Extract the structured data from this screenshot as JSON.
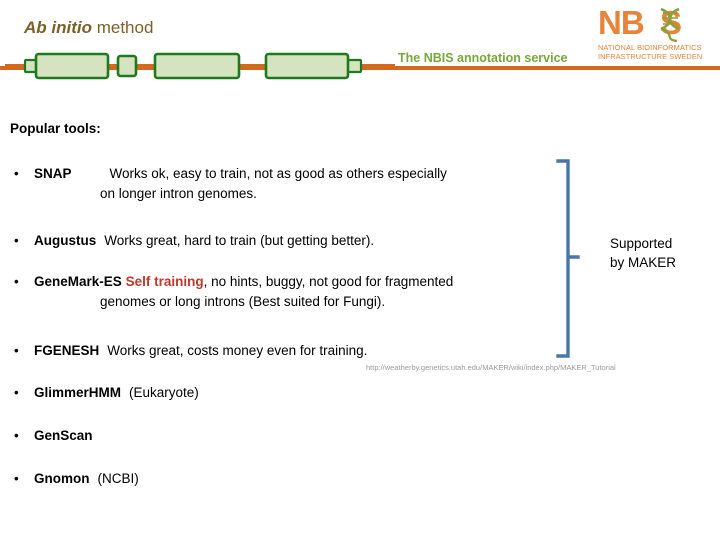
{
  "header": {
    "title_italic": "Ab initio",
    "title_rest": " method",
    "title_color": "#7d6029",
    "tagline": "The NBIS annotation service",
    "tagline_color": "#76a83c",
    "rule_color": "#d2691e",
    "logo": {
      "wordmark_left": "NB",
      "wordmark_right": "S",
      "subtitle_line1": "NATIONAL BIOINFORMATICS",
      "subtitle_line2": "INFRASTRUCTURE SWEDEN",
      "color": "#e8833a",
      "helix_icon": "dna-helix-icon"
    },
    "gene_diagram": {
      "icon": "gene-model-icon",
      "line_color": "#d2691e",
      "exon_fill": "#d5e3c0",
      "exon_stroke": "#1e7a1e"
    }
  },
  "main": {
    "section_heading": "Popular tools:",
    "bullets": [
      {
        "marker": "•",
        "name": "SNAP",
        "desc_line1": "Works ok, easy to train, not as good as others especially",
        "desc_line2": "on longer intron genomes.",
        "highlight": "",
        "highlight_color": ""
      },
      {
        "marker": "•",
        "name": "Augustus",
        "desc_line1": "Works great, hard to train (but getting better).",
        "desc_line2": "",
        "highlight": "",
        "highlight_color": ""
      },
      {
        "marker": "•",
        "name": "GeneMark-ES",
        "highlight": "Self training",
        "highlight_color": "#c0392b",
        "desc_line1": ", no hints, buggy, not good for fragmented",
        "desc_line2": "genomes or long introns (Best suited for Fungi)."
      },
      {
        "marker": "•",
        "name": "FGENESH",
        "desc_line1": "Works great, costs money even for training.",
        "desc_line2": "",
        "highlight": "",
        "highlight_color": ""
      },
      {
        "marker": "•",
        "name": "GlimmerHMM",
        "desc_line1": "(Eukaryote)",
        "desc_line2": "",
        "highlight": "",
        "highlight_color": ""
      },
      {
        "marker": "•",
        "name": "GenScan",
        "desc_line1": "",
        "desc_line2": "",
        "highlight": "",
        "highlight_color": ""
      },
      {
        "marker": "•",
        "name": "Gnomon",
        "desc_line1": "(NCBI)",
        "desc_line2": "",
        "highlight": "",
        "highlight_color": ""
      }
    ]
  },
  "callout": {
    "brace_icon": "curly-brace-icon",
    "brace_color": "#4a77a8",
    "line1": "Supported",
    "line2": "by MAKER"
  },
  "footer": {
    "source_url": "http://weatherby.genetics.utah.edu/MAKER/wiki/index.php/MAKER_Tutorial",
    "url_color": "#9a9a9a"
  }
}
